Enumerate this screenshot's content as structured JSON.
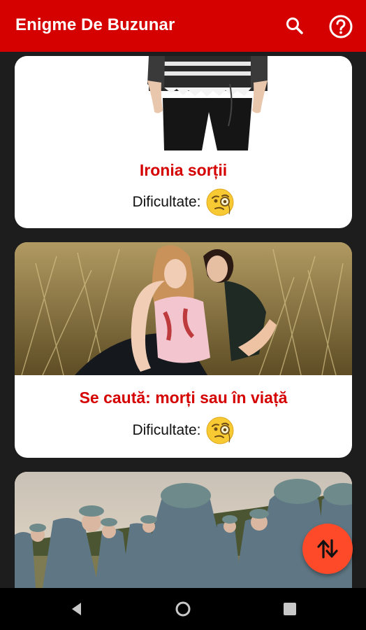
{
  "app": {
    "title": "Enigme De Buzunar"
  },
  "toolbar": {
    "search_icon": "search-icon",
    "help_icon": "help-circle-icon"
  },
  "cards": [
    {
      "title": "Ironia sorții",
      "difficulty_label": "Dificultate:",
      "difficulty_icon": "thinking-face-monocle-emoji"
    },
    {
      "title": "Se caută: morți sau în viață",
      "difficulty_label": "Dificultate:",
      "difficulty_icon": "thinking-face-monocle-emoji"
    },
    {
      "title": "",
      "difficulty_label": "",
      "difficulty_icon": ""
    }
  ],
  "fab": {
    "icon": "sort-swap-icon"
  },
  "navigation": {
    "back": "back-icon",
    "home": "home-icon",
    "recents": "recents-icon"
  },
  "colors": {
    "primary": "#d50000",
    "accent": "#ff4a2a",
    "background": "#1d1d1d"
  }
}
